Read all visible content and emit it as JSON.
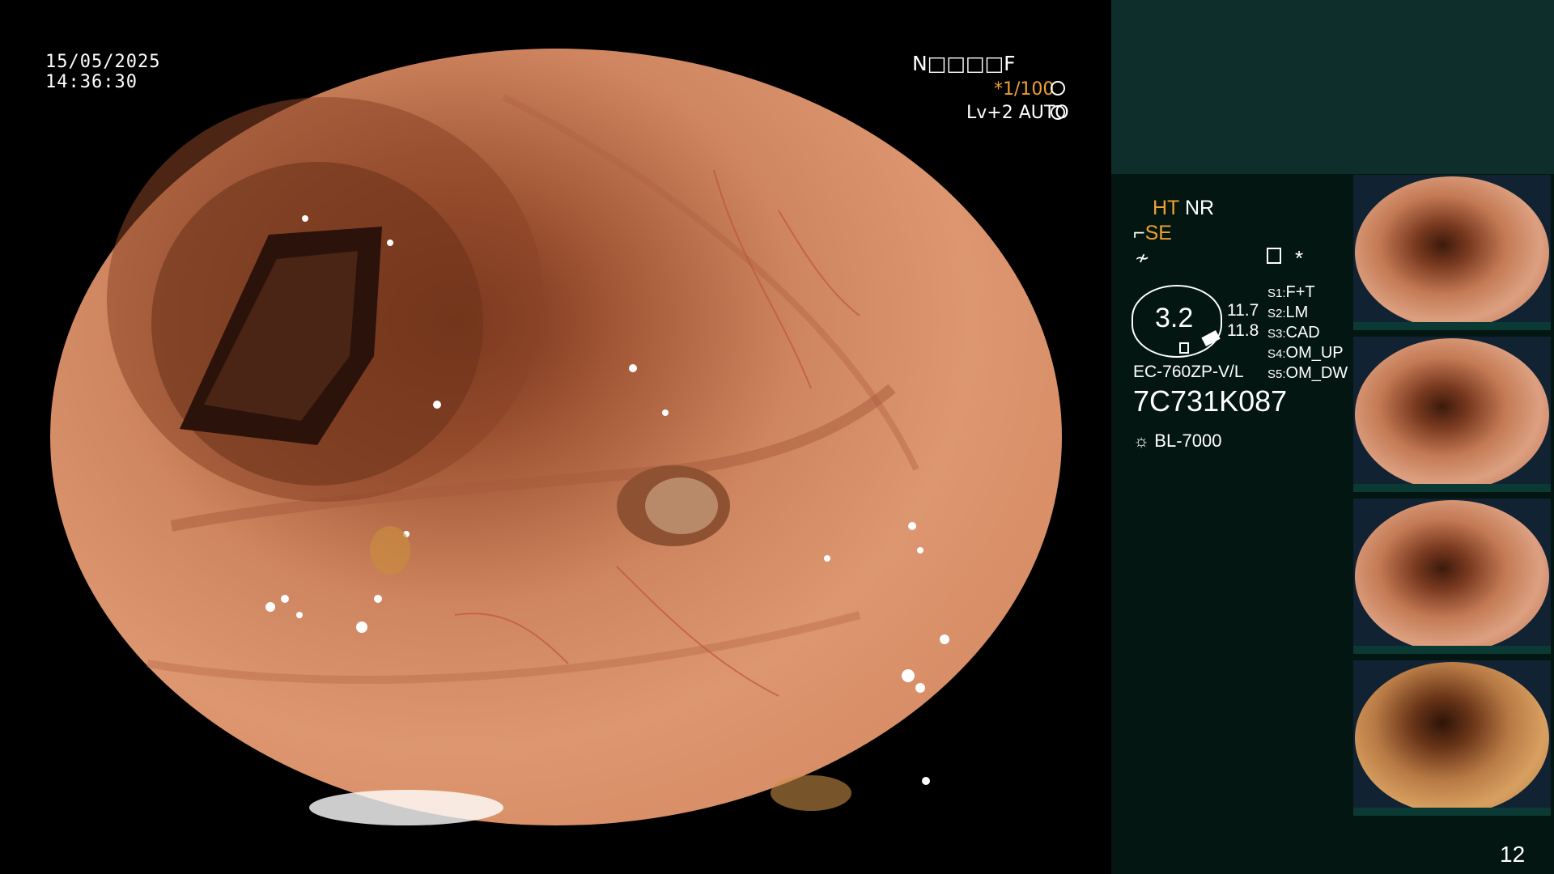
{
  "osd_left": {
    "date": "15/05/2025",
    "time": "14:36:30"
  },
  "osd_right": {
    "patient_code": "N□□□□F",
    "shutter": "*1/100",
    "level": "Lv+2  AUTO"
  },
  "panel": {
    "ht": "HT",
    "nr": "NR",
    "se": "SE",
    "gauge_value": "3.2",
    "value_a": "11.7",
    "value_b": "11.8",
    "scope_model": "EC-760ZP-V/L",
    "serial": "7C731K087",
    "light_source": "BL-7000",
    "star": "*",
    "switches": [
      {
        "key": "S1:",
        "val": "F+T"
      },
      {
        "key": "S2:",
        "val": "LM"
      },
      {
        "key": "S3:",
        "val": "CAD"
      },
      {
        "key": "S4:",
        "val": "OM_UP"
      },
      {
        "key": "S5:",
        "val": "OM_DW"
      }
    ]
  },
  "page_number": "12",
  "colors": {
    "accent_orange": "#f0a030",
    "panel_bg": "#041611",
    "panel_top": "#0d2e2a"
  }
}
